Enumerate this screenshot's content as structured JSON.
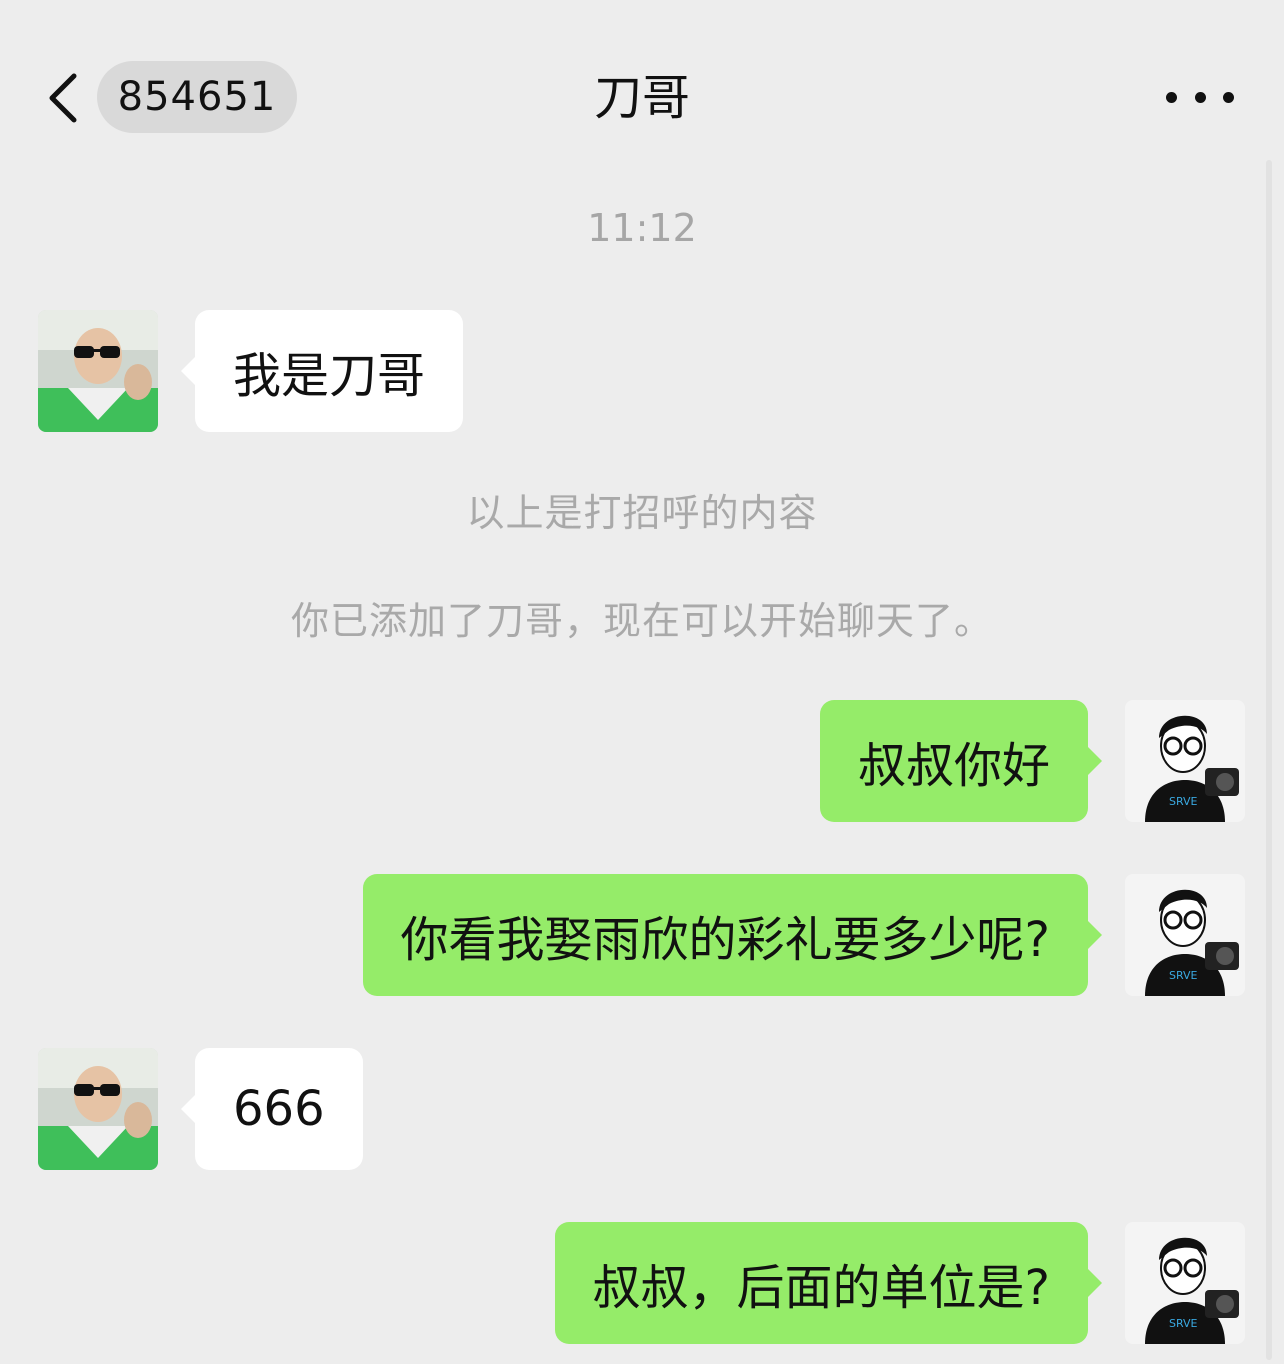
{
  "header": {
    "back_icon": "chevron-left-icon",
    "unread_count": "854651",
    "title": "刀哥",
    "more_icon": "ellipsis-icon"
  },
  "chat": {
    "timestamp": "11:12",
    "system_greeting": "以上是打招呼的内容",
    "system_added": "你已添加了刀哥，现在可以开始聊天了。",
    "messages": [
      {
        "side": "in",
        "text": "我是刀哥"
      },
      {
        "side": "out",
        "text": "叔叔你好"
      },
      {
        "side": "out",
        "text": "你看我娶雨欣的彩礼要多少呢?"
      },
      {
        "side": "in",
        "text": "666"
      },
      {
        "side": "out",
        "text": "叔叔，后面的单位是?"
      }
    ]
  },
  "colors": {
    "background": "#ededed",
    "incoming_bubble": "#ffffff",
    "outgoing_bubble": "#95ec69",
    "system_text": "#a9a9a9"
  }
}
